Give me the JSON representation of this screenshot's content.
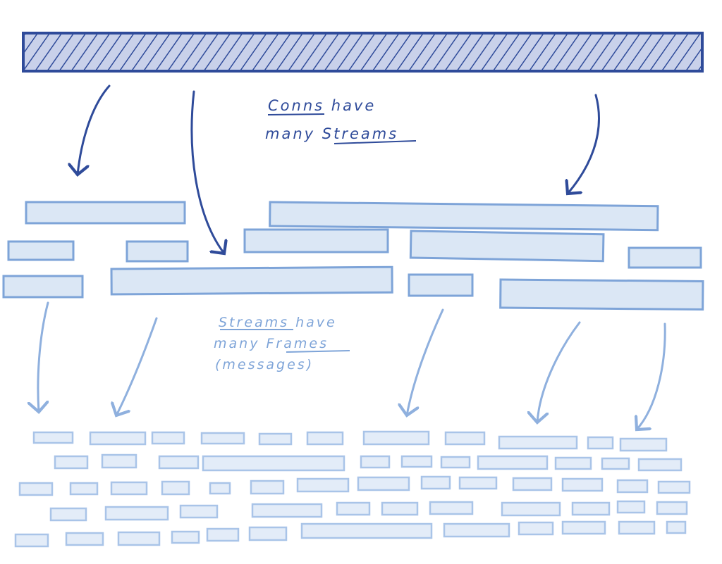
{
  "annotations": {
    "connections": {
      "line1": [
        "Conns",
        " have"
      ],
      "line2": [
        "many ",
        "Streams"
      ]
    },
    "streams": {
      "line1": [
        "Streams",
        " have"
      ],
      "line2": [
        "many ",
        "Frames"
      ],
      "line3": "(messages)"
    }
  },
  "colors": {
    "connection": "#2f4b9a",
    "connection_fill": "#c9d1ea",
    "stream_stroke": "#7ea4d8",
    "stream_fill": "#dbe7f5",
    "frame_stroke": "#a9c4e8",
    "frame_fill": "#e3ecf8"
  }
}
